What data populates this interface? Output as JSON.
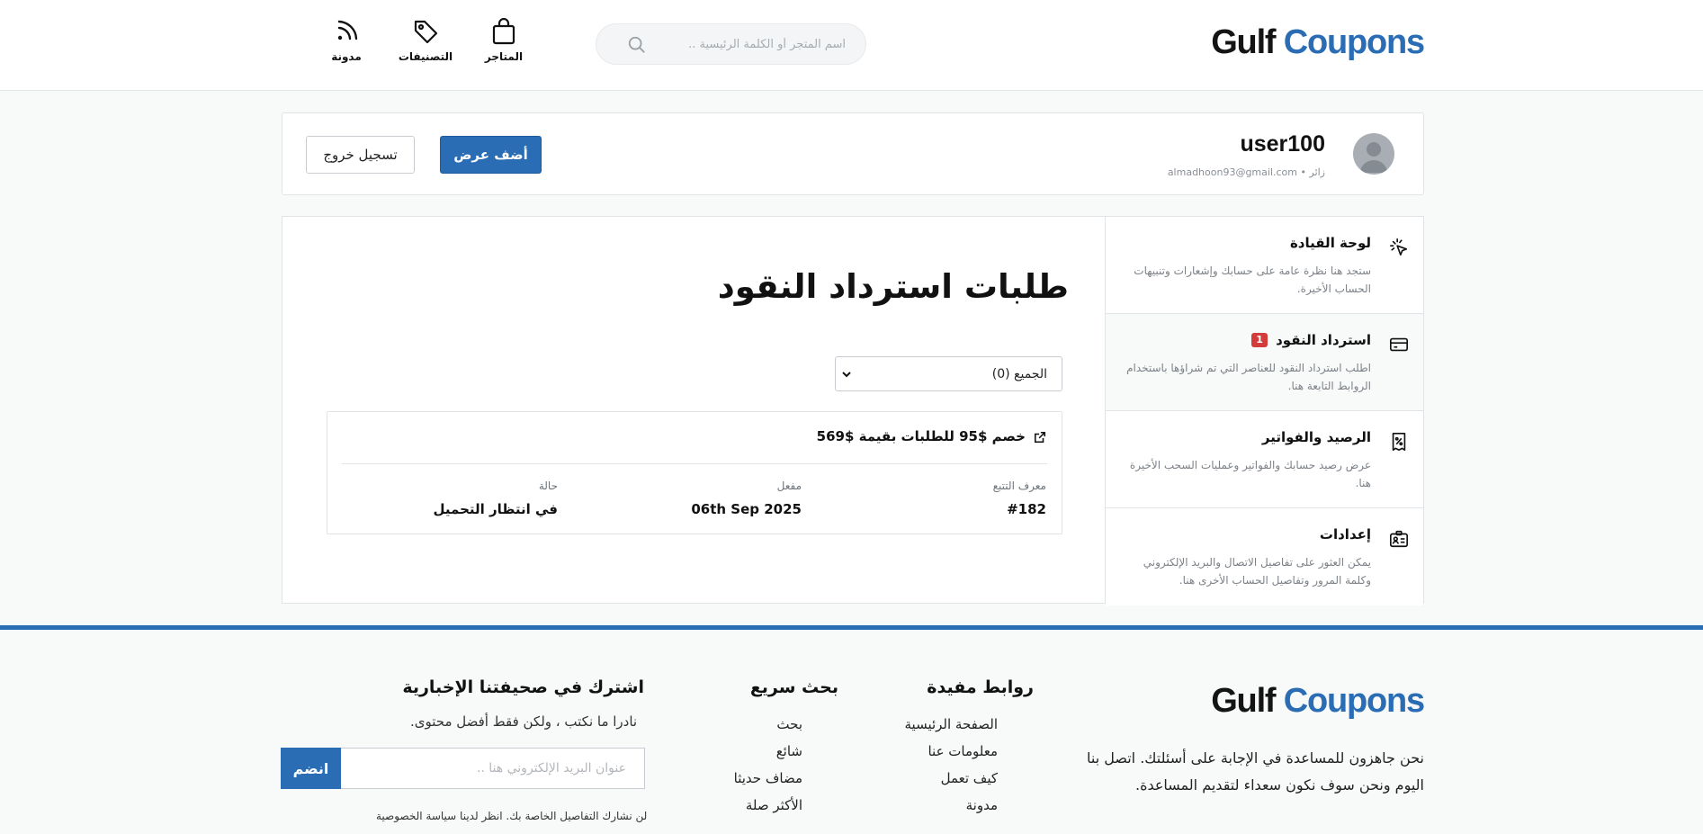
{
  "header": {
    "logo_part1": "Gulf",
    "logo_part2": "Coupons",
    "search_placeholder": "اسم المتجر أو الكلمة الرئيسية ..",
    "nav": {
      "stores": "المتاجر",
      "categories": "التصنيفات",
      "blog": "مدونة"
    }
  },
  "profile": {
    "username": "user100",
    "role": "زائر",
    "email": "almadhoon93@gmail.com",
    "add_offer_label": "أضف عرض",
    "logout_label": "تسجيل خروج"
  },
  "sidebar": {
    "items": [
      {
        "title": "لوحة القيادة",
        "description": "ستجد هنا نظرة عامة على حسابك وإشعارات وتنبيهات الحساب الأخيرة.",
        "icon": "dashboard-cursor-icon"
      },
      {
        "title": "استرداد النقود",
        "badge": "1",
        "description": "اطلب استرداد النقود للعناصر التي تم شراؤها باستخدام الروابط التابعة هنا.",
        "icon": "credit-card-icon"
      },
      {
        "title": "الرصيد والفواتير",
        "description": "عرض رصيد حسابك والفواتير وعمليات السحب الأخيرة هنا.",
        "icon": "receipt-percent-icon"
      },
      {
        "title": "إعدادات",
        "description": "يمكن العثور على تفاصيل الاتصال والبريد الإلكتروني وكلمة المرور وتفاصيل الحساب الأخرى هنا.",
        "icon": "id-card-icon"
      }
    ]
  },
  "content": {
    "title": "طلبات استرداد النقود",
    "filter_selected": "الجميع (0)",
    "order": {
      "title": "خصم $95 للطلبات بقيمة $569",
      "fields": {
        "tracking_id_label": "معرف التتبع",
        "tracking_id_value": "#182",
        "activated_label": "مفعل",
        "activated_value": "06th Sep 2025",
        "status_label": "حالة",
        "status_value": "في انتظار التحميل"
      }
    }
  },
  "footer": {
    "about": "نحن جاهزون للمساعدة في الإجابة على أسئلتك. اتصل بنا اليوم ونحن سوف نكون سعداء لتقديم المساعدة.",
    "useful_links": {
      "heading": "روابط مفيدة",
      "links": [
        "الصفحة الرئيسية",
        "معلومات عنا",
        "كيف تعمل",
        "مدونة"
      ]
    },
    "quick_search": {
      "heading": "بحث سريع",
      "links": [
        "بحث",
        "شائع",
        "مضاف حديثا",
        "الأكثر صلة"
      ]
    },
    "newsletter": {
      "heading": "اشترك في صحيفتنا الإخبارية",
      "description": "نادرا ما نكتب ، ولكن فقط أفضل محتوى.",
      "placeholder": "عنوان البريد الإلكتروني هنا ..",
      "join_label": "انضم",
      "privacy_note": "لن نشارك التفاصيل الخاصة بك. انظر لدينا سياسة الخصوصية"
    }
  },
  "colors": {
    "brand_blue": "#2a6db5",
    "badge_red": "#d43b3b"
  }
}
